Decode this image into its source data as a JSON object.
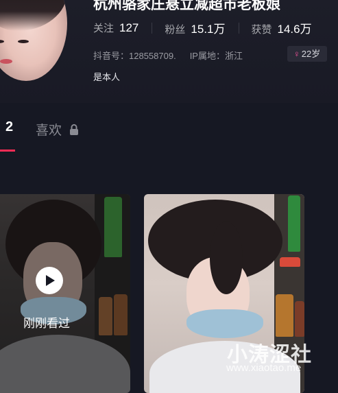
{
  "profile": {
    "name": "杭州骆家庄悬立减超市老板娘",
    "stats": [
      {
        "label": "关注",
        "value": "127"
      },
      {
        "label": "粉丝",
        "value": "15.1万"
      },
      {
        "label": "获赞",
        "value": "14.6万"
      }
    ],
    "douyin_id": "抖音号：128558709.",
    "ip_location": "IP属地：浙江",
    "age_badge": "22岁",
    "gender_symbol": "♀",
    "verified_text": "是本人"
  },
  "tabs": {
    "works_label": "2",
    "likes_label": "喜欢"
  },
  "videos": [
    {
      "overlay_text": "刚刚看过"
    },
    {
      "overlay_text": ""
    }
  ],
  "watermark": {
    "cn": "小涛涩社",
    "url": "www.xiaotao.me"
  },
  "colors": {
    "background": "#161823",
    "accent": "#fe2c55",
    "gender_pink": "#f5519b"
  }
}
